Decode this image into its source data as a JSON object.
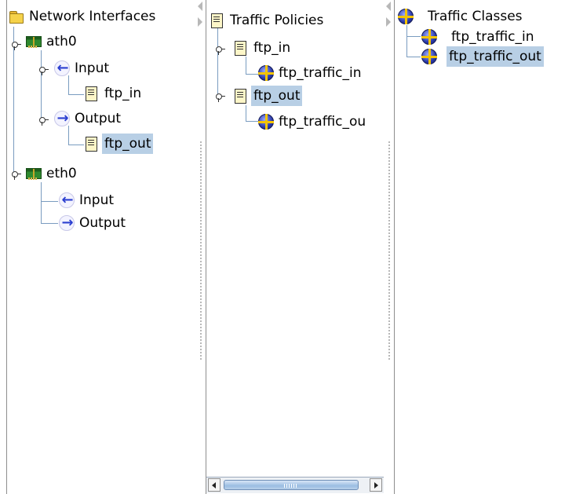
{
  "interfaces_pane": {
    "root": "Network Interfaces",
    "interfaces": [
      {
        "name": "ath0",
        "directions": [
          {
            "label": "Input",
            "policy": "ftp_in"
          },
          {
            "label": "Output",
            "policy": "ftp_out"
          }
        ]
      },
      {
        "name": "eth0",
        "directions": [
          {
            "label": "Input"
          },
          {
            "label": "Output"
          }
        ]
      }
    ],
    "selected": "ftp_out"
  },
  "policies_pane": {
    "root": "Traffic Policies",
    "policies": [
      {
        "name": "ftp_in",
        "class": "ftp_traffic_in"
      },
      {
        "name": "ftp_out",
        "class": "ftp_traffic_ou"
      }
    ],
    "selected": "ftp_out"
  },
  "classes_pane": {
    "root": "Traffic Classes",
    "classes": [
      "ftp_traffic_in",
      "ftp_traffic_out"
    ],
    "selected": "ftp_traffic_out"
  },
  "colors": {
    "selection": "#b8cfe5",
    "tree_line": "#7a9cc0"
  },
  "icons": {
    "root_interfaces": "folder-icon",
    "interface": "network-card-icon",
    "input": "left-arrow-icon",
    "output": "right-arrow-icon",
    "policy": "document-icon",
    "class": "traffic-class-icon"
  }
}
